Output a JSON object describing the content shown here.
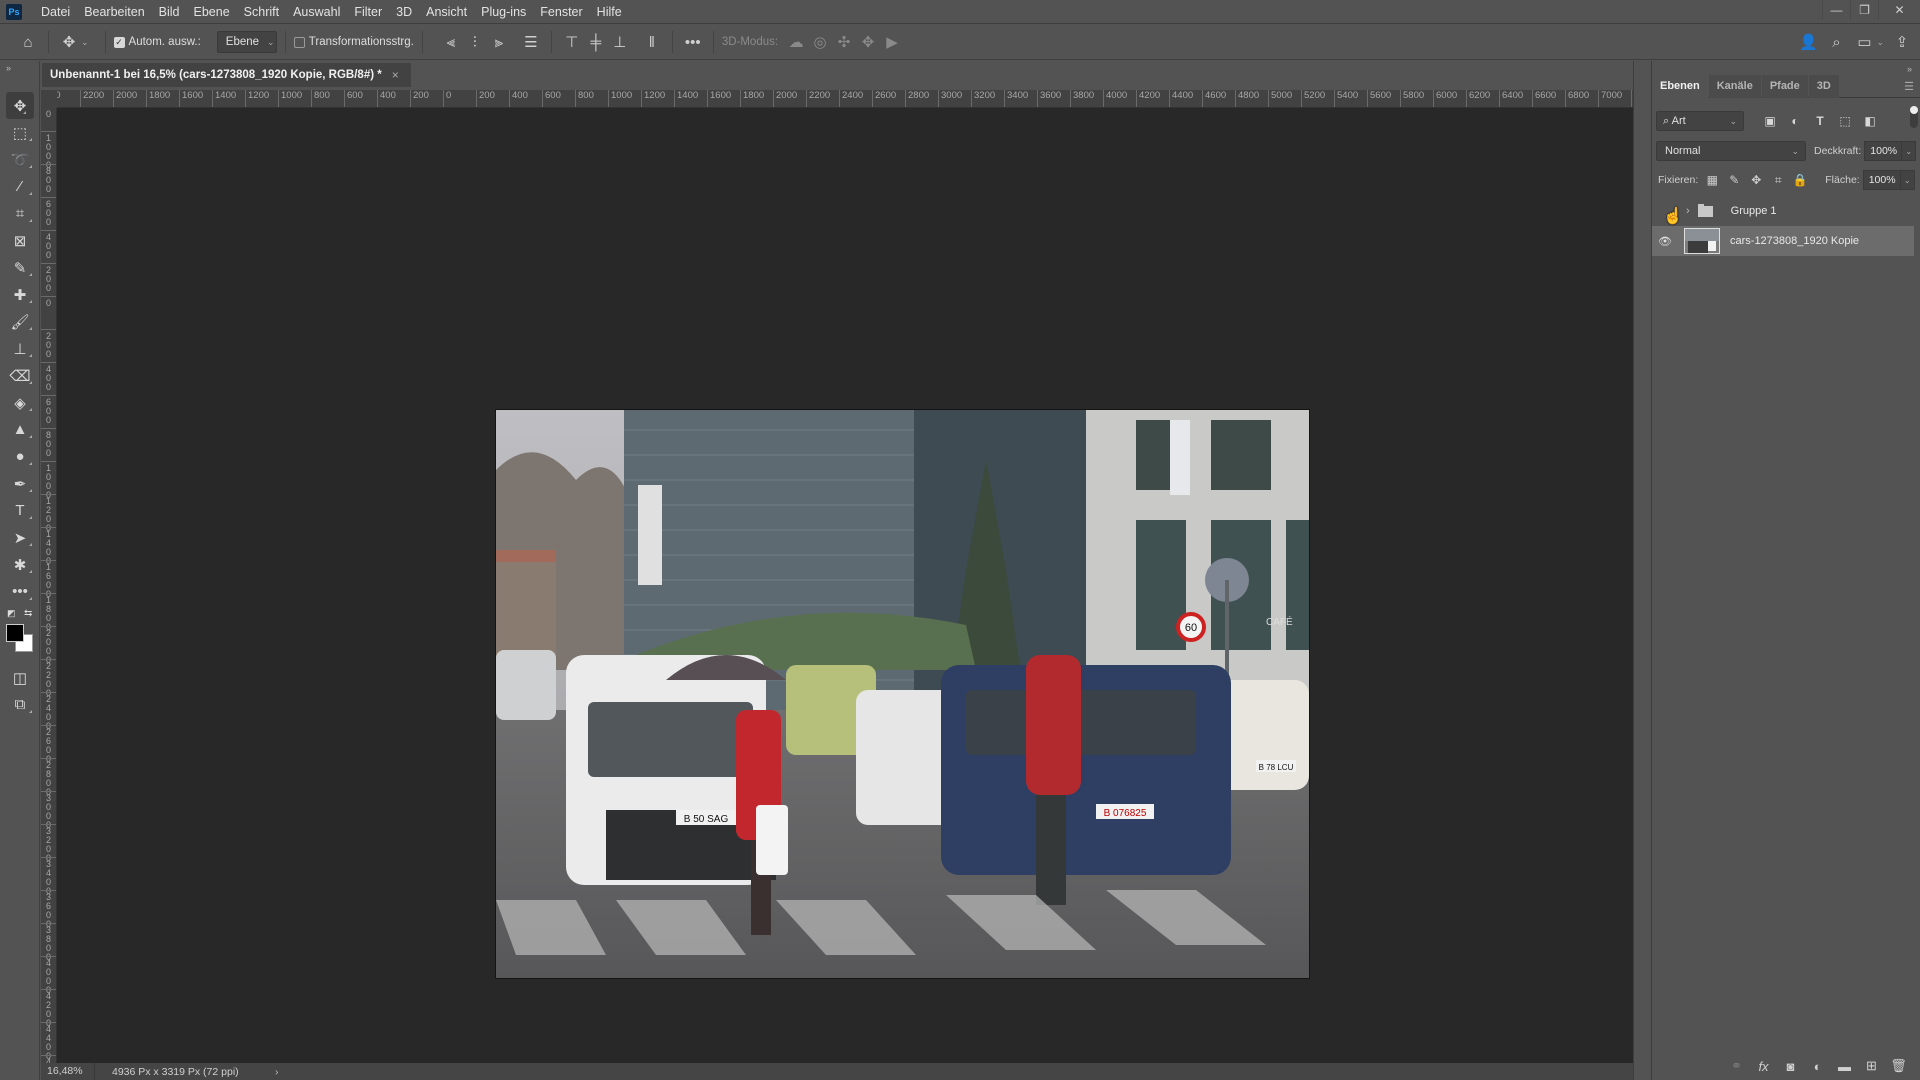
{
  "app": {
    "logo": "Ps",
    "menu": [
      "Datei",
      "Bearbeiten",
      "Bild",
      "Ebene",
      "Schrift",
      "Auswahl",
      "Filter",
      "3D",
      "Ansicht",
      "Plug-ins",
      "Fenster",
      "Hilfe"
    ],
    "window_controls": {
      "minimize": "—",
      "restore": "❐",
      "close": "✕"
    }
  },
  "options_bar": {
    "home_icon": "home-icon",
    "move_icon": "move-icon",
    "auto_select_label": "Autom. ausw.:",
    "auto_select_checked": true,
    "auto_select_target": "Ebene",
    "transform_controls_label": "Transformationsstrg.",
    "transform_controls_checked": false,
    "more_label": "•••",
    "mode_3d_label": "3D-Modus:"
  },
  "document": {
    "tab_title": "Unbenannt-1 bei 16,5% (cars-1273808_1920 Kopie, RGB/8#) *",
    "close": "×"
  },
  "rulers": {
    "horizontal": [
      "00",
      "2200",
      "2000",
      "1800",
      "1600",
      "1400",
      "1200",
      "1000",
      "800",
      "600",
      "400",
      "200",
      "0",
      "200",
      "400",
      "600",
      "800",
      "1000",
      "1200",
      "1400",
      "1600",
      "1800",
      "2000",
      "2200",
      "2400",
      "2600",
      "2800",
      "3000",
      "3200",
      "3400",
      "3600",
      "3800",
      "4000",
      "4200",
      "4400",
      "4600",
      "4800",
      "5000",
      "5200",
      "5400",
      "5600",
      "5800",
      "6000",
      "6200",
      "6400",
      "6600",
      "6800",
      "7000",
      "7"
    ],
    "vertical": [
      "00",
      "1000",
      "800",
      "600",
      "400",
      "200",
      "0",
      "200",
      "400",
      "600",
      "800",
      "1000",
      "1200",
      "1400",
      "1600",
      "1800",
      "2000",
      "2200",
      "2400",
      "2600",
      "2800",
      "3000",
      "3200",
      "3400",
      "3600",
      "3800",
      "4000",
      "4200",
      "4400",
      "4600"
    ]
  },
  "photo": {
    "description": "Rainy street crosswalk with pedestrians in red jackets and cars",
    "plates": [
      "B 50 SAG",
      "B 076825",
      "B 78 LCU"
    ],
    "sign": "60",
    "cafe": "CAFÉ"
  },
  "status": {
    "zoom": "16,48%",
    "doc_size": "4936 Px x 3319 Px (72 ppi)",
    "arrow": "›"
  },
  "panel": {
    "tabs": [
      "Ebenen",
      "Kanäle",
      "Pfade",
      "3D"
    ],
    "active_tab": "Ebenen",
    "filter_kind": "Art",
    "blend_mode": "Normal",
    "opacity_label": "Deckkraft:",
    "opacity": "100%",
    "lock_label": "Fixieren:",
    "fill_label": "Fläche:",
    "fill": "100%",
    "layers": [
      {
        "name": "Gruppe 1",
        "type": "group",
        "visible": false
      },
      {
        "name": "cars-1273808_1920 Kopie",
        "type": "smart-object",
        "visible": true,
        "selected": true
      }
    ]
  },
  "colors": {
    "foreground": "#000000",
    "background": "#ffffff",
    "ui_bg": "#535353",
    "canvas_bg": "#282828"
  }
}
